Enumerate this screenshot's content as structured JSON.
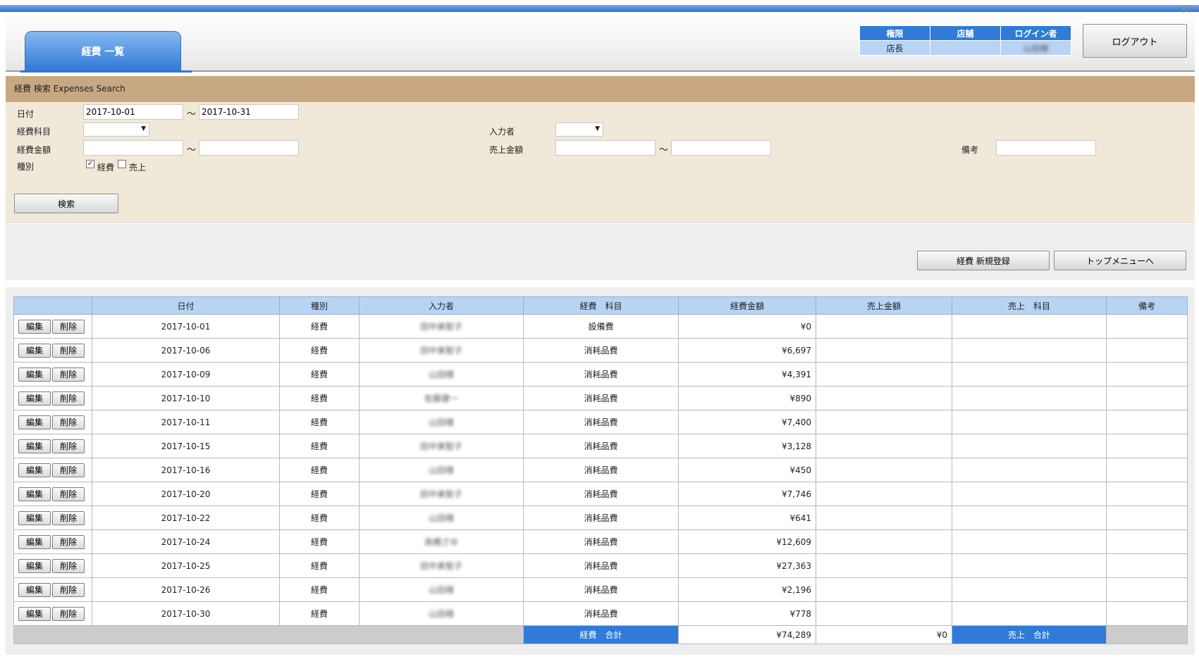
{
  "header": {
    "tab_label": "経費 一覧",
    "userinfo": {
      "col_role": "権限",
      "col_store": "店舗",
      "col_user": "ログイン者",
      "role": "店長",
      "store": "",
      "user": "山田様"
    },
    "logout_label": "ログアウト"
  },
  "search": {
    "title": "経費 検索  Expenses Search",
    "date_label": "日付",
    "date_from": "2017-10-01",
    "date_to": "2017-10-31",
    "tilde": "～",
    "category_label": "経費科目",
    "inputter_label": "入力者",
    "expense_amount_label": "経費金額",
    "sales_amount_label": "売上金額",
    "remarks_label": "備考",
    "kind_label": "種別",
    "kind_expense": "経費",
    "kind_sales": "売上",
    "kind_expense_checked": "✓",
    "search_button": "検索"
  },
  "actions": {
    "new_expense": "経費 新規登録",
    "top_menu": "トップメニューへ"
  },
  "table": {
    "headers": [
      "",
      "日付",
      "種別",
      "入力者",
      "経費　科目",
      "経費金額",
      "売上金額",
      "売上　科目",
      "備考"
    ],
    "edit_label": "編集",
    "delete_label": "削除",
    "rows": [
      {
        "date": "2017-10-01",
        "kind": "経費",
        "user": "田中美智子",
        "category": "設備費",
        "amount": "¥0"
      },
      {
        "date": "2017-10-06",
        "kind": "経費",
        "user": "田中美智子",
        "category": "消耗品費",
        "amount": "¥6,697"
      },
      {
        "date": "2017-10-09",
        "kind": "経費",
        "user": "山田様",
        "category": "消耗品費",
        "amount": "¥4,391"
      },
      {
        "date": "2017-10-10",
        "kind": "経費",
        "user": "佐藤健一",
        "category": "消耗品費",
        "amount": "¥890"
      },
      {
        "date": "2017-10-11",
        "kind": "経費",
        "user": "山田様",
        "category": "消耗品費",
        "amount": "¥7,400"
      },
      {
        "date": "2017-10-15",
        "kind": "経費",
        "user": "田中美智子",
        "category": "消耗品費",
        "amount": "¥3,128"
      },
      {
        "date": "2017-10-16",
        "kind": "経費",
        "user": "山田様",
        "category": "消耗品費",
        "amount": "¥450"
      },
      {
        "date": "2017-10-20",
        "kind": "経費",
        "user": "田中美智子",
        "category": "消耗品費",
        "amount": "¥7,746"
      },
      {
        "date": "2017-10-22",
        "kind": "経費",
        "user": "山田様",
        "category": "消耗品費",
        "amount": "¥641"
      },
      {
        "date": "2017-10-24",
        "kind": "経費",
        "user": "高橋さゆ",
        "category": "消耗品費",
        "amount": "¥12,609"
      },
      {
        "date": "2017-10-25",
        "kind": "経費",
        "user": "田中美智子",
        "category": "消耗品費",
        "amount": "¥27,363"
      },
      {
        "date": "2017-10-26",
        "kind": "経費",
        "user": "山田様",
        "category": "消耗品費",
        "amount": "¥2,196"
      },
      {
        "date": "2017-10-30",
        "kind": "経費",
        "user": "山田様",
        "category": "消耗品費",
        "amount": "¥778"
      }
    ],
    "totals": {
      "expense_label": "経費　合計",
      "expense_total": "¥74,289",
      "sales_total": "¥0",
      "sales_label": "売上　合計"
    }
  }
}
